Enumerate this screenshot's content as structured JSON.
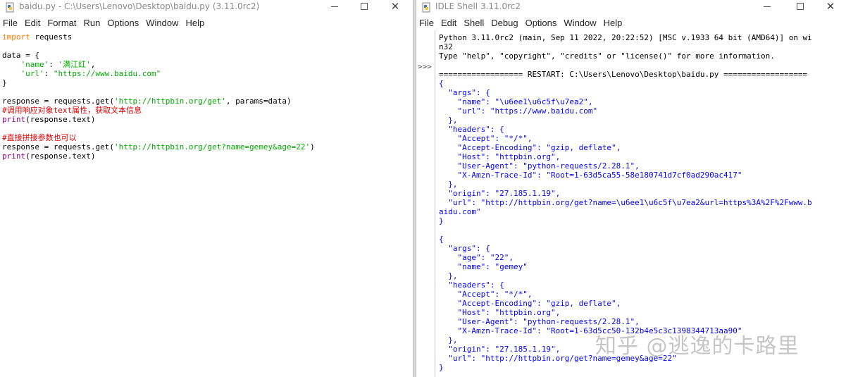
{
  "editor": {
    "title": "baidu.py - C:\\Users\\Lenovo\\Desktop\\baidu.py (3.11.0rc2)",
    "menu": [
      "File",
      "Edit",
      "Format",
      "Run",
      "Options",
      "Window",
      "Help"
    ],
    "code": [
      {
        "segs": [
          {
            "t": "import",
            "c": "kw"
          },
          {
            "t": " requests",
            "c": ""
          }
        ]
      },
      {
        "segs": []
      },
      {
        "segs": [
          {
            "t": "data = {",
            "c": ""
          }
        ]
      },
      {
        "segs": [
          {
            "t": "    ",
            "c": ""
          },
          {
            "t": "'name'",
            "c": "str"
          },
          {
            "t": ": ",
            "c": ""
          },
          {
            "t": "'满江红'",
            "c": "str"
          },
          {
            "t": ",",
            "c": ""
          }
        ]
      },
      {
        "segs": [
          {
            "t": "    ",
            "c": ""
          },
          {
            "t": "'url'",
            "c": "str"
          },
          {
            "t": ": ",
            "c": ""
          },
          {
            "t": "\"https://www.baidu.com\"",
            "c": "str"
          }
        ]
      },
      {
        "segs": [
          {
            "t": "}",
            "c": ""
          }
        ]
      },
      {
        "segs": []
      },
      {
        "segs": [
          {
            "t": "response = requests.get(",
            "c": ""
          },
          {
            "t": "'http://httpbin.org/get'",
            "c": "str"
          },
          {
            "t": ", params=data)",
            "c": ""
          }
        ]
      },
      {
        "segs": [
          {
            "t": "#调用响应对象text属性，获取文本信息",
            "c": "cmt"
          }
        ]
      },
      {
        "segs": [
          {
            "t": "print",
            "c": "bi"
          },
          {
            "t": "(response.text)",
            "c": ""
          }
        ]
      },
      {
        "segs": []
      },
      {
        "segs": [
          {
            "t": "#直接拼接参数也可以",
            "c": "cmt"
          }
        ]
      },
      {
        "segs": [
          {
            "t": "response = requests.get(",
            "c": ""
          },
          {
            "t": "'http://httpbin.org/get?name=gemey&age=22'",
            "c": "str"
          },
          {
            "t": ")",
            "c": ""
          }
        ]
      },
      {
        "segs": [
          {
            "t": "print",
            "c": "bi"
          },
          {
            "t": "(response.text)",
            "c": ""
          }
        ]
      }
    ]
  },
  "shell": {
    "title": "IDLE Shell 3.11.0rc2",
    "menu": [
      "File",
      "Edit",
      "Shell",
      "Debug",
      "Options",
      "Window",
      "Help"
    ],
    "prompt": ">>>",
    "lines": [
      {
        "t": "Python 3.11.0rc2 (main, Sep 11 2022, 20:22:52) [MSC v.1933 64 bit (AMD64)] on wi",
        "c": ""
      },
      {
        "t": "n32",
        "c": ""
      },
      {
        "t": "Type \"help\", \"copyright\", \"credits\" or \"license()\" for more information.",
        "c": ""
      },
      {
        "t": "",
        "c": ""
      },
      {
        "t": "================== RESTART: C:\\Users\\Lenovo\\Desktop\\baidu.py ==================",
        "c": ""
      },
      {
        "t": "{",
        "c": "out"
      },
      {
        "t": "  \"args\": {",
        "c": "out"
      },
      {
        "t": "    \"name\": \"\\u6ee1\\u6c5f\\u7ea2\",",
        "c": "out"
      },
      {
        "t": "    \"url\": \"https://www.baidu.com\"",
        "c": "out"
      },
      {
        "t": "  },",
        "c": "out"
      },
      {
        "t": "  \"headers\": {",
        "c": "out"
      },
      {
        "t": "    \"Accept\": \"*/*\",",
        "c": "out"
      },
      {
        "t": "    \"Accept-Encoding\": \"gzip, deflate\",",
        "c": "out"
      },
      {
        "t": "    \"Host\": \"httpbin.org\",",
        "c": "out"
      },
      {
        "t": "    \"User-Agent\": \"python-requests/2.28.1\",",
        "c": "out"
      },
      {
        "t": "    \"X-Amzn-Trace-Id\": \"Root=1-63d5ca55-58e180741d7cf0ad290ac417\"",
        "c": "out"
      },
      {
        "t": "  },",
        "c": "out"
      },
      {
        "t": "  \"origin\": \"27.185.1.19\",",
        "c": "out"
      },
      {
        "t": "  \"url\": \"http://httpbin.org/get?name=\\u6ee1\\u6c5f\\u7ea2&url=https%3A%2F%2Fwww.b",
        "c": "out"
      },
      {
        "t": "aidu.com\"",
        "c": "out"
      },
      {
        "t": "}",
        "c": "out"
      },
      {
        "t": "",
        "c": ""
      },
      {
        "t": "{",
        "c": "out"
      },
      {
        "t": "  \"args\": {",
        "c": "out"
      },
      {
        "t": "    \"age\": \"22\",",
        "c": "out"
      },
      {
        "t": "    \"name\": \"gemey\"",
        "c": "out"
      },
      {
        "t": "  },",
        "c": "out"
      },
      {
        "t": "  \"headers\": {",
        "c": "out"
      },
      {
        "t": "    \"Accept\": \"*/*\",",
        "c": "out"
      },
      {
        "t": "    \"Accept-Encoding\": \"gzip, deflate\",",
        "c": "out"
      },
      {
        "t": "    \"Host\": \"httpbin.org\",",
        "c": "out"
      },
      {
        "t": "    \"User-Agent\": \"python-requests/2.28.1\",",
        "c": "out"
      },
      {
        "t": "    \"X-Amzn-Trace-Id\": \"Root=1-63d5cc50-132b4e5c3c1398344713aa90\"",
        "c": "out"
      },
      {
        "t": "  },",
        "c": "out"
      },
      {
        "t": "  \"origin\": \"27.185.1.19\",",
        "c": "out"
      },
      {
        "t": "  \"url\": \"http://httpbin.org/get?name=gemey&age=22\"",
        "c": "out"
      },
      {
        "t": "}",
        "c": "out"
      }
    ]
  },
  "watermark": "知乎 @逃逸的卡路里",
  "colors": {
    "keyword": "#ff7700",
    "builtin": "#900090",
    "string": "#00aa00",
    "comment": "#dd0000",
    "stdout": "#0000ff"
  },
  "icons": {
    "app": "python-file-icon",
    "minimize": "minimize-icon",
    "maximize": "maximize-icon",
    "close": "close-icon"
  }
}
